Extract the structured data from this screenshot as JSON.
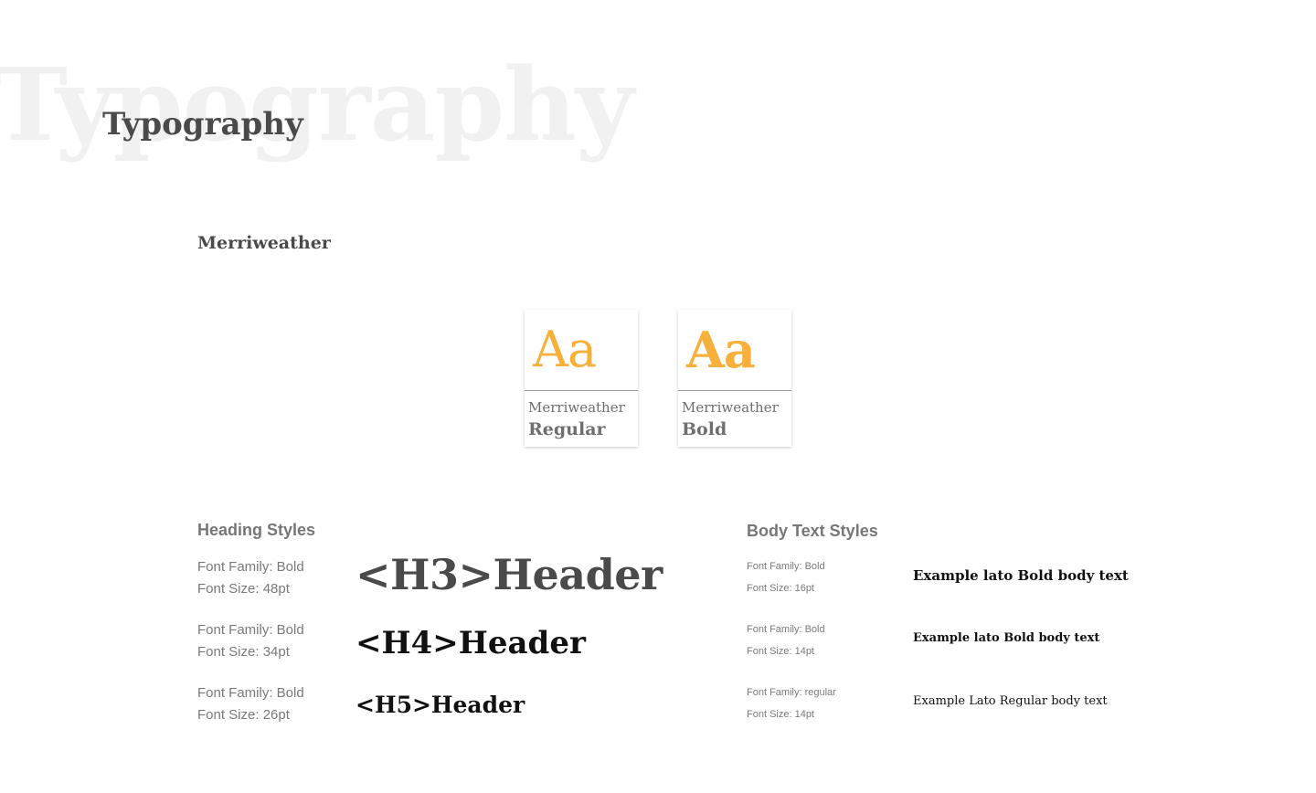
{
  "background_word": "Typography",
  "page_title": "Typography",
  "font_name": "Merriweather",
  "cards": [
    {
      "sample": "Aa",
      "family": "Merriweather",
      "weight": "Regular"
    },
    {
      "sample": "Aa",
      "family": "Merriweather",
      "weight": "Bold"
    }
  ],
  "accent_color": "#f7b03c",
  "heading_styles": {
    "title": "Heading Styles",
    "items": [
      {
        "family_label": "Font Family:  Bold",
        "size_label": "Font Size: 48pt",
        "example": "<H3>Header"
      },
      {
        "family_label": "Font Family:  Bold",
        "size_label": "Font Size: 34pt",
        "example": "<H4>Header"
      },
      {
        "family_label": "Font Family:  Bold",
        "size_label": "Font Size: 26pt",
        "example": "<H5>Header"
      }
    ]
  },
  "body_styles": {
    "title": "Body Text Styles",
    "items": [
      {
        "family_label": "Font Family: Bold",
        "size_label": "Font Size: 16pt",
        "example": "Example lato Bold body text"
      },
      {
        "family_label": "Font Family: Bold",
        "size_label": "Font Size: 14pt",
        "example": "Example lato Bold body text"
      },
      {
        "family_label": "Font Family: regular",
        "size_label": "Font Size: 14pt",
        "example": "Example Lato Regular body text"
      }
    ]
  }
}
